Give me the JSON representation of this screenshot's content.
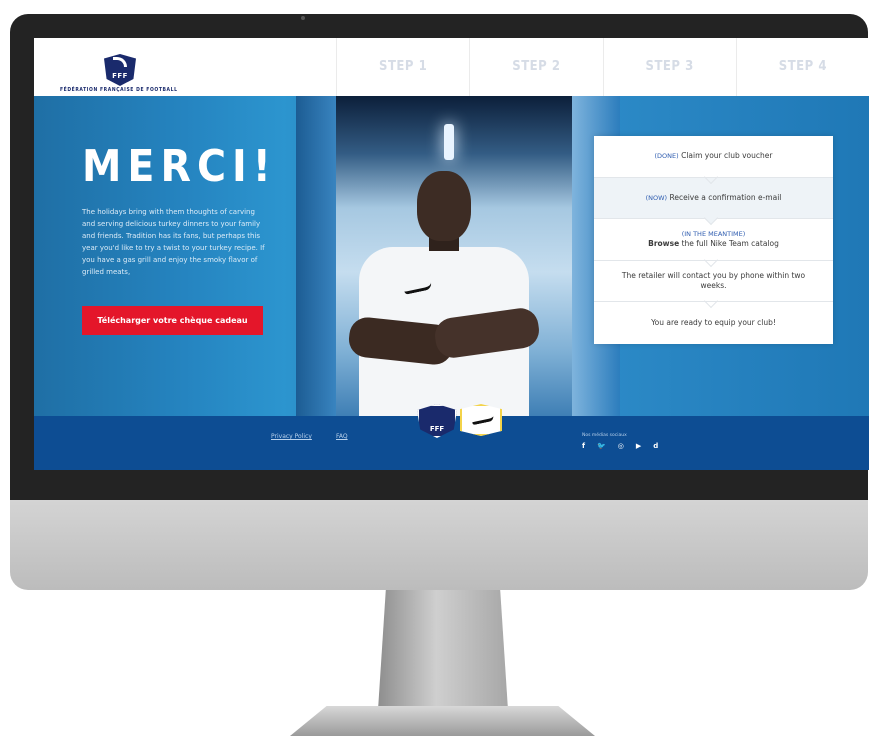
{
  "header": {
    "logo_text": "FFF",
    "federation_name": "FÉDÉRATION FRANÇAISE DE FOOTBALL",
    "steps": [
      "STEP 1",
      "STEP 2",
      "STEP 3",
      "STEP 4"
    ]
  },
  "hero": {
    "title": "MERCI!",
    "intro": "The holidays bring with them thoughts of carving and serving delicious turkey dinners to your family and friends. Tradition has its fans, but perhaps this year you'd like to try a twist to your turkey recipe. If you have a gas grill and enjoy the smoky flavor of grilled meats,",
    "cta_label": "Télécharger votre chèque cadeau"
  },
  "checklist": [
    {
      "tag": "(DONE)",
      "text": "Claim your club voucher",
      "tag_inline": true
    },
    {
      "tag": "(NOW)",
      "text": "Receive a confirmation e-mail",
      "tag_inline": true
    },
    {
      "tag": "(IN THE MEANTIME)",
      "bold": "Browse",
      "text": "the full Nike Team catalog"
    },
    {
      "text": "The retailer will contact you by phone within two weeks."
    },
    {
      "text": "You are ready to equip your club!"
    }
  ],
  "footer": {
    "privacy_label": "Privacy Policy",
    "faq_label": "FAQ",
    "badge_text": "FFF",
    "social_label": "Nos médias sociaux",
    "social_icons": [
      "f",
      "twitter-icon",
      "instagram-icon",
      "youtube-icon",
      "dailymotion-icon"
    ],
    "social_glyphs": [
      "f",
      "🐦",
      "◎",
      "▶",
      "d"
    ]
  },
  "colors": {
    "header_blue": "#1a2a6c",
    "cta_red": "#e4162a",
    "footer_blue": "#0d4d93",
    "tag_blue": "#2f5db0"
  }
}
